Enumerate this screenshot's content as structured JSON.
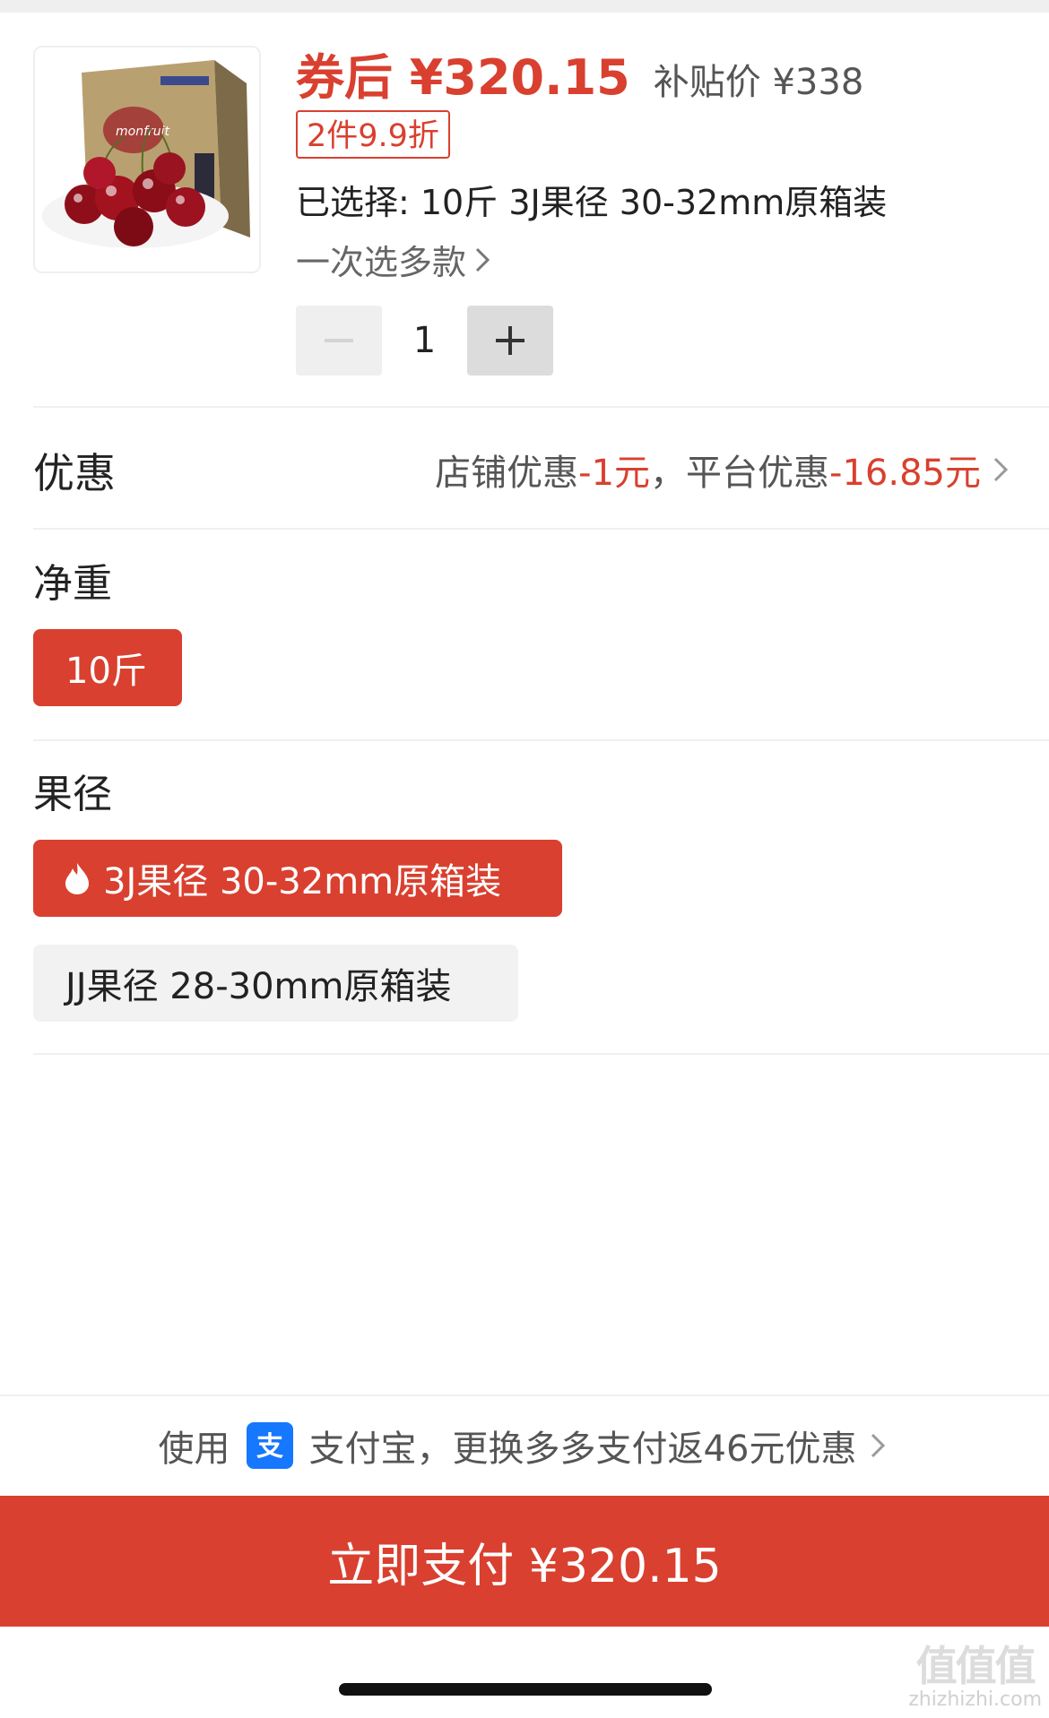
{
  "product": {
    "price_after_coupon": "券后 ¥320.15",
    "subsidy_price": "补贴价 ¥338",
    "deal_badge": "2件9.9折",
    "selected_text": "已选择: 10斤 3J果径 30-32mm原箱装",
    "multi_select_label": "一次选多款",
    "quantity": "1"
  },
  "discount": {
    "label": "优惠",
    "store_prefix": "店铺优惠",
    "store_amount": "-1元",
    "separator": "，",
    "platform_prefix": "平台优惠",
    "platform_amount": "-16.85元"
  },
  "weight": {
    "title": "净重",
    "options": [
      {
        "label": "10斤",
        "selected": true
      }
    ]
  },
  "diameter": {
    "title": "果径",
    "options": [
      {
        "label": "3J果径 30-32mm原箱装",
        "selected": true,
        "hot": true
      },
      {
        "label": "JJ果径 28-30mm原箱装",
        "selected": false
      }
    ]
  },
  "payment_tip": {
    "prefix": "使用",
    "method": "支付宝，更换多多支付返46元优惠"
  },
  "pay_button": {
    "label": "立即支付 ¥320.15"
  },
  "watermark": {
    "logo_text": "值值值",
    "site": "zhizhizhi.com"
  },
  "colors": {
    "accent": "#d9402f",
    "alipay": "#1677ff"
  },
  "icons": [
    "cherry-box-image",
    "chevron-right-icon",
    "minus-icon",
    "plus-icon",
    "fire-icon",
    "alipay-icon"
  ]
}
